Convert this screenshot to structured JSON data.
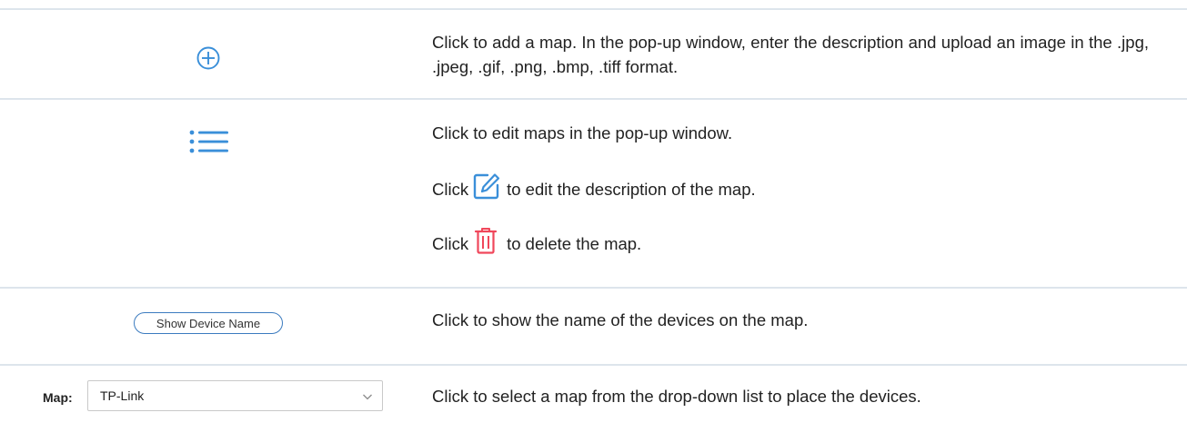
{
  "rows": [
    {
      "icon": "add-circle-icon",
      "description": "Click to add a map. In the pop-up window, enter the description and upload an image in the .jpg, .jpeg, .gif, .png, .bmp, .tiff format."
    },
    {
      "icon": "list-icon",
      "description": "Click to edit maps in the pop-up window.",
      "edit_line": {
        "prefix": "Click",
        "icon": "edit-icon",
        "suffix": "to edit the description of the map."
      },
      "delete_line": {
        "prefix": "Click",
        "icon": "trash-icon",
        "suffix": "to delete the map."
      }
    },
    {
      "button_label": "Show Device Name",
      "description": "Click to show the name of the devices on the map."
    },
    {
      "select_label": "Map:",
      "select_value": "TP-Link",
      "description": "Click to select a map from the drop-down list to place the devices."
    }
  ],
  "colors": {
    "icon_blue": "#3a8fd9",
    "delete_red": "#f0475b",
    "divider": "#dde5ec",
    "button_border": "#3b7bbf"
  }
}
